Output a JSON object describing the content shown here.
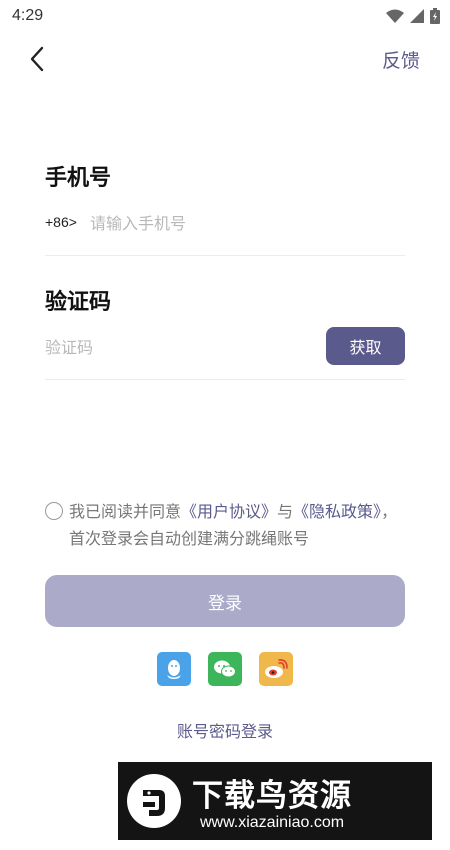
{
  "status_bar": {
    "time": "4:29"
  },
  "header": {
    "feedback_label": "反馈"
  },
  "phone": {
    "label": "手机号",
    "prefix": "+86>",
    "placeholder": "请输入手机号"
  },
  "code": {
    "label": "验证码",
    "placeholder": "验证码",
    "get_code_label": "获取"
  },
  "agreement": {
    "text_1": "我已阅读并同意",
    "user_agreement": "《用户协议》",
    "connector": "与",
    "privacy_policy": "《隐私政策》",
    "text_2": "，首次登录会自动创建满分跳绳账号"
  },
  "login": {
    "label": "登录"
  },
  "social": [
    {
      "icon": "qq-icon",
      "color": "#4aa3e8"
    },
    {
      "icon": "wechat-icon",
      "color": "#3cb55b"
    },
    {
      "icon": "weibo-icon",
      "color": "#f0b74a"
    }
  ],
  "password_login_label": "账号密码登录",
  "watermark": {
    "title": "下载鸟资源",
    "url": "www.xiazainiao.com"
  },
  "colors": {
    "accent": "#5b5a8c",
    "login_disabled": "#abaac8"
  }
}
